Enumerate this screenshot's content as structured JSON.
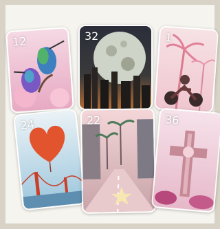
{
  "cards": [
    {
      "number": "12",
      "subject": "hummingbirds",
      "icon": "hummingbird-icon"
    },
    {
      "number": "32",
      "subject": "moon over city",
      "icon": "moon-icon"
    },
    {
      "number": "1",
      "subject": "palm trees and motorcycle",
      "icon": "palm-tree-icon"
    },
    {
      "number": "24",
      "subject": "heart balloon over bridge",
      "icon": "heart-icon"
    },
    {
      "number": "22",
      "subject": "palm-lined street",
      "icon": "street-icon"
    },
    {
      "number": "36",
      "subject": "cross",
      "icon": "cross-icon"
    }
  ],
  "colors": {
    "background": "#d8d3c6",
    "frame": "#f6f4ef"
  }
}
